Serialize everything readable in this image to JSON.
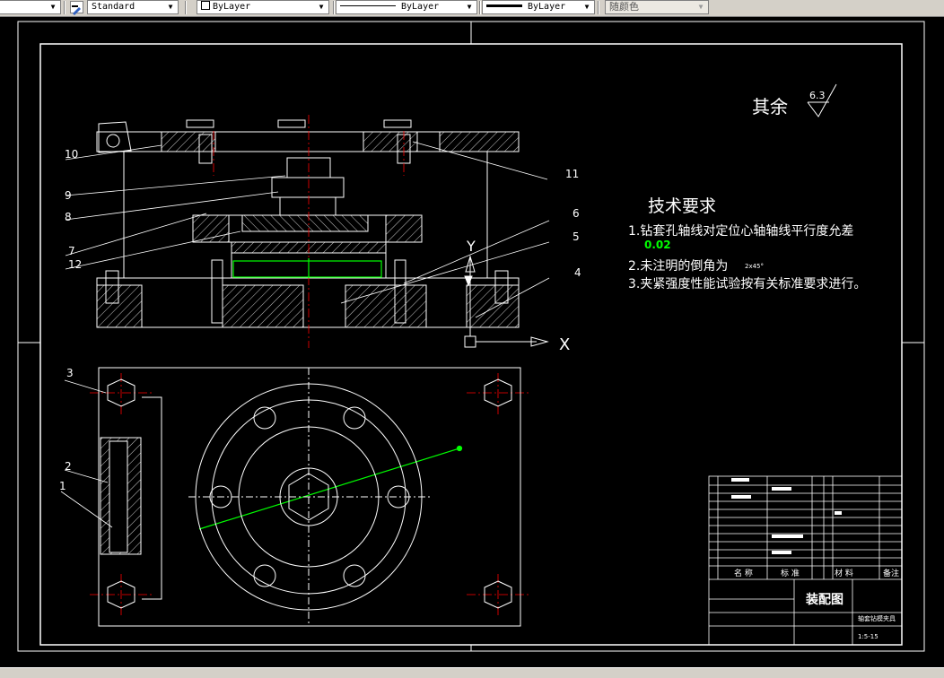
{
  "toolbar": {
    "text_style": "Standard",
    "color": "ByLayer",
    "linetype": "ByLayer",
    "lineweight": "ByLayer",
    "plot_style": "随颜色"
  },
  "drawing": {
    "surface_finish_label": "其余",
    "surface_roughness": "6.3",
    "tech_req_title": "技术要求",
    "tech_req_1": "1.钻套孔轴线对定位心轴轴线平行度允差",
    "tech_req_1_value": "0.02",
    "tech_req_2": "2.未注明的倒角为",
    "tech_req_2_value": "2x45°",
    "tech_req_3": "3.夹紧强度性能试验按有关标准要求进行。",
    "balloons_front": [
      "10",
      "9",
      "8",
      "7",
      "12",
      "11",
      "6",
      "5",
      "4"
    ],
    "balloons_top": [
      "3",
      "2",
      "1"
    ],
    "axis_y": "Y",
    "axis_x": "X",
    "title_block": {
      "col_name": "名 称",
      "col_standard": "标 准",
      "col_material": "材 料",
      "col_remark": "备注",
      "drawing_title": "装配图",
      "part_name": "轴套钻模夹具",
      "drawing_no": "1:5-15"
    }
  },
  "colors": {
    "background": "#000000",
    "lines": "#ffffff",
    "centerline": "#ff0000",
    "highlight": "#00ff00",
    "toolbar": "#d4d0c8"
  }
}
